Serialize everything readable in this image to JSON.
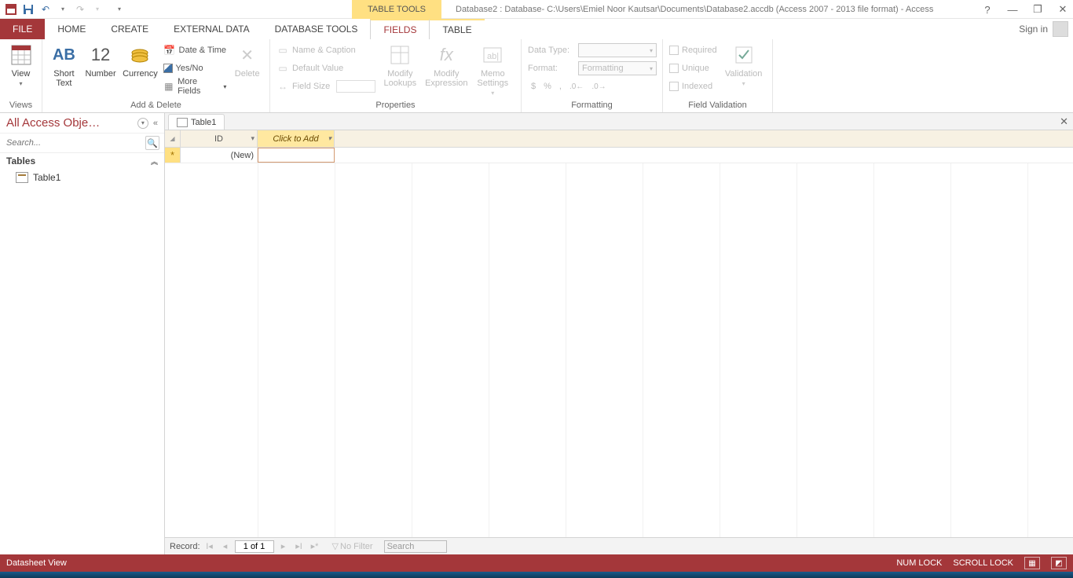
{
  "titlebar": {
    "contextual": "TABLE TOOLS",
    "apptitle": "Database2 : Database- C:\\Users\\Emiel Noor Kautsar\\Documents\\Database2.accdb (Access 2007 - 2013 file format) - Access"
  },
  "tabs": {
    "file": "FILE",
    "home": "HOME",
    "create": "CREATE",
    "external": "EXTERNAL DATA",
    "dbtools": "DATABASE TOOLS",
    "fields": "FIELDS",
    "table": "TABLE",
    "signin": "Sign in"
  },
  "ribbon": {
    "views": {
      "view": "View",
      "group": "Views"
    },
    "add": {
      "short": "Short Text",
      "number": "Number",
      "currency": "Currency",
      "ab": "AB",
      "twelve": "12",
      "date": "Date & Time",
      "yesno": "Yes/No",
      "more": "More Fields",
      "delete": "Delete",
      "group": "Add & Delete"
    },
    "props": {
      "name": "Name & Caption",
      "default": "Default Value",
      "size": "Field Size",
      "lookups": "Modify Lookups",
      "expr": "Modify Expression",
      "memo": "Memo Settings",
      "group": "Properties"
    },
    "fmt": {
      "datatype": "Data Type:",
      "format": "Format:",
      "formatting": "Formatting",
      "sym1": "$",
      "sym2": "%",
      "sym3": ",",
      "dec1": ".0←",
      "dec2": ".0→",
      "group": "Formatting"
    },
    "val": {
      "required": "Required",
      "unique": "Unique",
      "indexed": "Indexed",
      "validation": "Validation",
      "group": "Field Validation"
    }
  },
  "nav": {
    "title": "All Access Obje…",
    "search": "Search...",
    "tables": "Tables",
    "table1": "Table1"
  },
  "doc": {
    "tab": "Table1",
    "col_id": "ID",
    "col_add": "Click to Add",
    "newrow": "(New)"
  },
  "recnav": {
    "label": "Record:",
    "pos": "1 of 1",
    "nofilter": "No Filter",
    "search": "Search"
  },
  "status": {
    "left": "Datasheet View",
    "numlock": "NUM LOCK",
    "scrolllock": "SCROLL LOCK"
  }
}
